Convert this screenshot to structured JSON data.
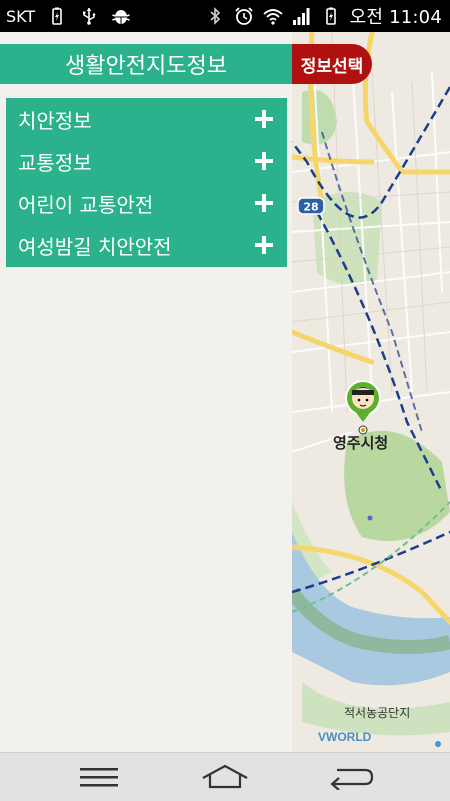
{
  "status_bar": {
    "carrier": "SKT",
    "clock": "오전 11:04",
    "left_icons": [
      "battery-charging-icon",
      "usb-icon",
      "android-debug-icon"
    ],
    "right_icons": [
      "bluetooth-icon",
      "alarm-icon",
      "wifi-icon",
      "signal-icon",
      "battery-icon"
    ]
  },
  "drawer": {
    "title": "생활안전지도정보",
    "menu_items": [
      {
        "label": "치안정보",
        "icon": "plus-icon"
      },
      {
        "label": "교통정보",
        "icon": "plus-icon"
      },
      {
        "label": "어린이 교통안전",
        "icon": "plus-icon"
      },
      {
        "label": "여성밤길 치안안전",
        "icon": "plus-icon"
      }
    ]
  },
  "map": {
    "info_select_label": "정보선택",
    "city_hall_label": "영주시청",
    "industrial_label": "적서농공단지",
    "route_badge": "28",
    "attribution": "VWORLD"
  },
  "nav_bar": {
    "buttons": [
      "menu-icon",
      "home-icon",
      "back-icon"
    ]
  },
  "colors": {
    "accent": "#2bb28c",
    "info_button": "#b0100f",
    "status_bar": "#000000",
    "nav_bar": "#e3e2e1"
  }
}
